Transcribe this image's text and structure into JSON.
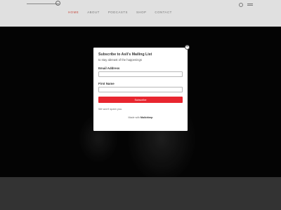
{
  "header": {
    "nav": [
      "HOME",
      "ABOUT",
      "PODCASTS",
      "SHOP",
      "CONTACT"
    ],
    "active_nav": "HOME"
  },
  "modal": {
    "title": "Subscribe to Asli's Mailing List",
    "subtitle": "to stay abreast of the happenings",
    "email_label": "Email Address",
    "first_name_label": "First Name",
    "email_value": "",
    "first_name_value": "",
    "button_label": "Subscribe",
    "note": "We won't spam you.",
    "footer_prefix": "Made with",
    "footer_brand": "Mailchimp",
    "close_glyph": "×"
  },
  "colors": {
    "accent": "#e8262f",
    "nav_active": "#e0564a"
  }
}
